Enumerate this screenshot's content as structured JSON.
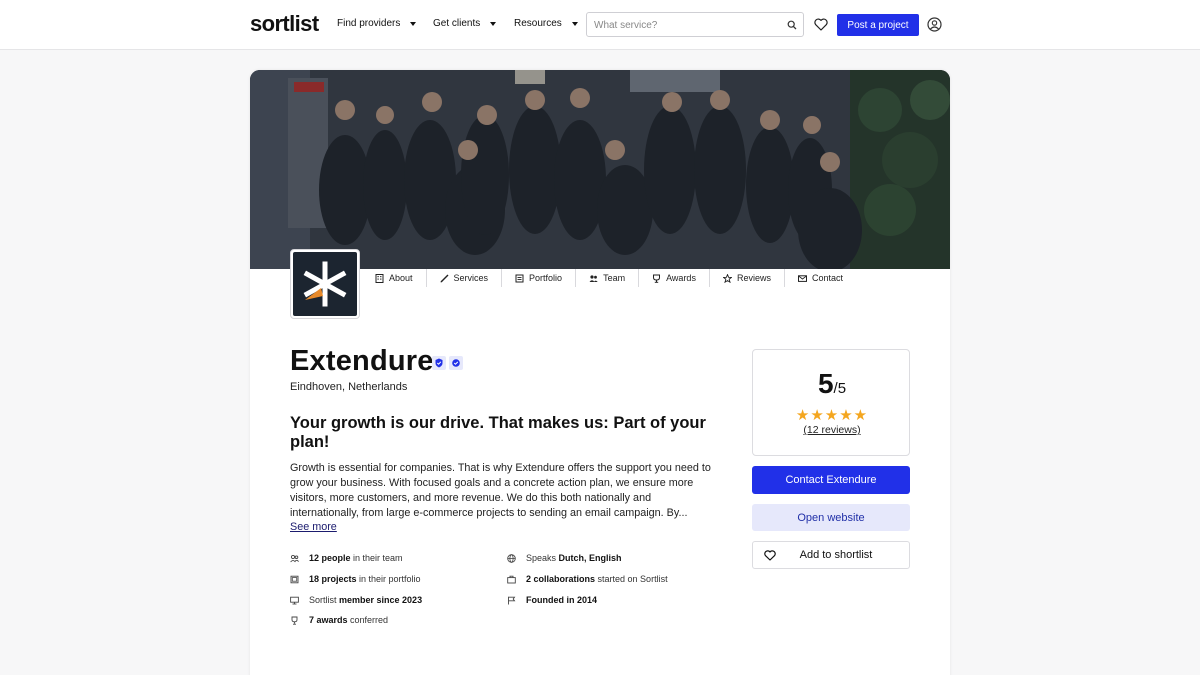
{
  "header": {
    "logo": "sortlist",
    "nav": [
      {
        "label": "Find providers"
      },
      {
        "label": "Get clients"
      },
      {
        "label": "Resources"
      }
    ],
    "search_placeholder": "What service?",
    "post_project": "Post a project"
  },
  "profile": {
    "tabs": [
      {
        "label": "About",
        "icon": "building-icon"
      },
      {
        "label": "Services",
        "icon": "pencil-icon"
      },
      {
        "label": "Portfolio",
        "icon": "portfolio-icon"
      },
      {
        "label": "Team",
        "icon": "team-icon"
      },
      {
        "label": "Awards",
        "icon": "award-icon"
      },
      {
        "label": "Reviews",
        "icon": "star-icon"
      },
      {
        "label": "Contact",
        "icon": "mail-icon"
      }
    ],
    "name": "Extendure",
    "location": "Eindhoven, Netherlands",
    "tagline": "Your growth is our drive. That makes us: Part of your plan!",
    "description": "Growth is essential for companies. That is why Extendure offers the support you need to grow your business. With focused goals and a concrete action plan, we ensure more visitors, more customers, and more revenue. We do this both nationally and internationally, from large e-commerce projects to sending an email campaign. By...",
    "see_more": "See more",
    "facts_left": [
      {
        "bold": "12 people",
        "rest": " in their team",
        "icon": "people-icon"
      },
      {
        "bold": "18 projects",
        "rest": " in their portfolio",
        "icon": "portfolio-icon"
      },
      {
        "pre": "Sortlist ",
        "bold": "member since 2023",
        "icon": "monitor-icon"
      },
      {
        "bold": "7 awards",
        "rest": " conferred",
        "icon": "trophy-icon"
      }
    ],
    "facts_right": [
      {
        "pre": "Speaks ",
        "bold": "Dutch, English",
        "icon": "globe-icon"
      },
      {
        "bold": "2 collaborations",
        "rest": " started on Sortlist",
        "icon": "briefcase-icon"
      },
      {
        "bold": "Founded in 2014",
        "icon": "flag-icon"
      }
    ]
  },
  "rating": {
    "score": "5",
    "out_of": "/5",
    "stars": 5,
    "reviews": "(12 reviews)"
  },
  "actions": {
    "contact": "Contact Extendure",
    "website": "Open website",
    "shortlist": "Add to shortlist"
  },
  "colors": {
    "primary": "#2130e8",
    "secondary_bg": "#e6e8fb",
    "star": "#f4a61f",
    "logo_orange": "#e88a2a"
  }
}
